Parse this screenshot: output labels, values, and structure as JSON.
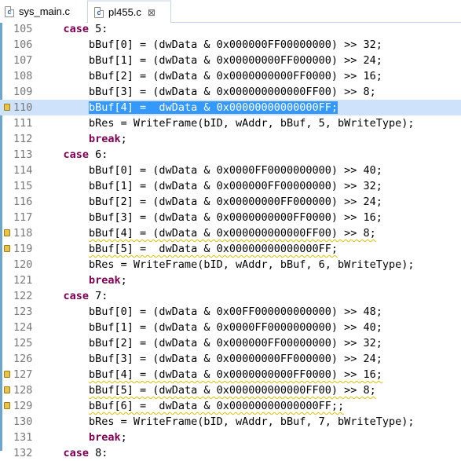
{
  "tabs": [
    {
      "label": "sys_main.c",
      "icon": "c-file-icon",
      "active": false
    },
    {
      "label": "pl455.c",
      "icon": "c-file-icon",
      "active": true,
      "close": "⊠"
    }
  ],
  "colors": {
    "keyword": "#7f0055",
    "line_number": "#787878",
    "selection": "#3399ff",
    "warning": "#e8c34a"
  },
  "lines": [
    {
      "n": "105",
      "text": "    case 5:"
    },
    {
      "n": "106",
      "text": "        bBuf[0] = (dwData & 0x000000FF00000000) >> 32;"
    },
    {
      "n": "107",
      "text": "        bBuf[1] = (dwData & 0x00000000FF000000) >> 24;"
    },
    {
      "n": "108",
      "text": "        bBuf[2] = (dwData & 0x0000000000FF0000) >> 16;"
    },
    {
      "n": "109",
      "text": "        bBuf[3] = (dwData & 0x000000000000FF00) >> 8;"
    },
    {
      "n": "110",
      "text": "        bBuf[4] =  dwData & 0x00000000000000FF;"
    },
    {
      "n": "111",
      "text": "        bRes = WriteFrame(bID, wAddr, bBuf, 5, bWriteType);"
    },
    {
      "n": "112",
      "text": "        break;"
    },
    {
      "n": "113",
      "text": "    case 6:"
    },
    {
      "n": "114",
      "text": "        bBuf[0] = (dwData & 0x0000FF0000000000) >> 40;"
    },
    {
      "n": "115",
      "text": "        bBuf[1] = (dwData & 0x000000FF00000000) >> 32;"
    },
    {
      "n": "116",
      "text": "        bBuf[2] = (dwData & 0x00000000FF000000) >> 24;"
    },
    {
      "n": "117",
      "text": "        bBuf[3] = (dwData & 0x0000000000FF0000) >> 16;"
    },
    {
      "n": "118",
      "text": "        bBuf[4] = (dwData & 0x000000000000FF00) >> 8;"
    },
    {
      "n": "119",
      "text": "        bBuf[5] =  dwData & 0x00000000000000FF;"
    },
    {
      "n": "120",
      "text": "        bRes = WriteFrame(bID, wAddr, bBuf, 6, bWriteType);"
    },
    {
      "n": "121",
      "text": "        break;"
    },
    {
      "n": "122",
      "text": "    case 7:"
    },
    {
      "n": "123",
      "text": "        bBuf[0] = (dwData & 0x00FF000000000000) >> 48;"
    },
    {
      "n": "124",
      "text": "        bBuf[1] = (dwData & 0x0000FF0000000000) >> 40;"
    },
    {
      "n": "125",
      "text": "        bBuf[2] = (dwData & 0x000000FF00000000) >> 32;"
    },
    {
      "n": "126",
      "text": "        bBuf[3] = (dwData & 0x00000000FF000000) >> 24;"
    },
    {
      "n": "127",
      "text": "        bBuf[4] = (dwData & 0x0000000000FF0000) >> 16;"
    },
    {
      "n": "128",
      "text": "        bBuf[5] = (dwData & 0x000000000000FF00) >> 8;"
    },
    {
      "n": "129",
      "text": "        bBuf[6] =  dwData & 0x00000000000000FF;;"
    },
    {
      "n": "130",
      "text": "        bRes = WriteFrame(bID, wAddr, bBuf, 7, bWriteType);"
    },
    {
      "n": "131",
      "text": "        break;"
    },
    {
      "n": "132",
      "text": "    case 8:"
    }
  ]
}
